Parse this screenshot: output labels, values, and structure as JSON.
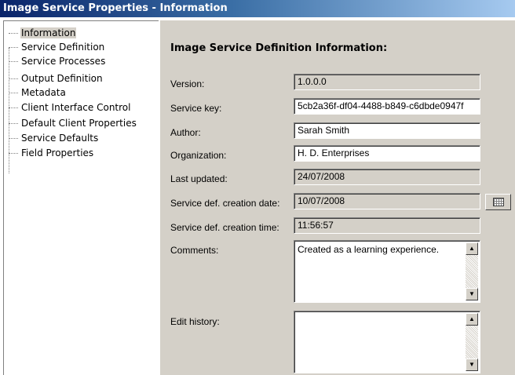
{
  "window": {
    "title": "Image Service Properties - Information"
  },
  "tree": {
    "items": [
      {
        "label": "Information",
        "selected": true
      },
      {
        "label": "Service Definition"
      },
      {
        "label": "Service Processes"
      },
      {
        "label": "Output Definition"
      },
      {
        "label": "Metadata"
      },
      {
        "label": "Client Interface Control"
      },
      {
        "label": "Default Client Properties"
      },
      {
        "label": "Service Defaults"
      },
      {
        "label": "Field Properties"
      }
    ]
  },
  "panel": {
    "heading": "Image Service Definition Information:",
    "fields": {
      "version": {
        "label": "Version:",
        "value": "1.0.0.0"
      },
      "service_key": {
        "label": "Service key:",
        "value": "5cb2a36f-df04-4488-b849-c6dbde0947f"
      },
      "author": {
        "label": "Author:",
        "value": "Sarah Smith"
      },
      "organization": {
        "label": "Organization:",
        "value": "H. D. Enterprises"
      },
      "last_updated": {
        "label": "Last updated:",
        "value": "24/07/2008"
      },
      "creation_date": {
        "label": "Service def. creation date:",
        "value": "10/07/2008"
      },
      "creation_time": {
        "label": "Service def. creation time:",
        "value": "11:56:57"
      },
      "comments": {
        "label": "Comments:",
        "value": "Created as a learning experience."
      },
      "edit_history": {
        "label": "Edit history:",
        "value": ""
      }
    },
    "icons": {
      "calendar": "calendar-icon",
      "scroll_up": "▲",
      "scroll_down": "▼"
    }
  }
}
